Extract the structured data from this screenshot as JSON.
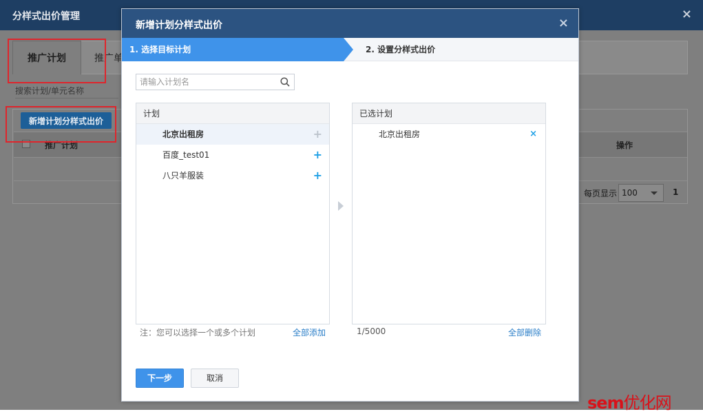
{
  "background": {
    "title": "分样式出价管理",
    "close_glyph": "×",
    "tabs": [
      {
        "label": "推广计划"
      },
      {
        "label": "推广单"
      }
    ],
    "search_placeholder": "搜索计划/单元名称",
    "add_button_label": "新增计划分样式出价",
    "table_headers": {
      "name": "推广计划",
      "operation": "操作"
    },
    "pager": {
      "per_page_label": "每页显示",
      "per_page_value": "100",
      "page_number": "1"
    }
  },
  "modal": {
    "title": "新增计划分样式出价",
    "close_glyph": "×",
    "steps": [
      {
        "label": "1. 选择目标计划"
      },
      {
        "label": "2. 设置分样式出价"
      }
    ],
    "search_placeholder": "请输入计划名",
    "left_panel": {
      "header": "计划",
      "items": [
        {
          "name": "北京出租房",
          "state": "selected",
          "action_glyph": "+"
        },
        {
          "name": "百度_test01",
          "state": "available",
          "action_glyph": "+"
        },
        {
          "name": "八只羊服装",
          "state": "available",
          "action_glyph": "+"
        }
      ],
      "note": "注：您可以选择一个或多个计划",
      "add_all_label": "全部添加"
    },
    "right_panel": {
      "header": "已选计划",
      "items": [
        {
          "name": "北京出租房",
          "remove_glyph": "×"
        }
      ],
      "count": "1/5000",
      "delete_all_label": "全部删除"
    },
    "next_button_label": "下一步",
    "cancel_button_label": "取消"
  },
  "watermark": {
    "brand": "sem",
    "text": "优化网"
  },
  "colors": {
    "accent": "#3f93ea",
    "header": "#2c5381",
    "link": "#2a7ec8",
    "plus": "#1fa0e6",
    "annotation": "#e0242b"
  }
}
